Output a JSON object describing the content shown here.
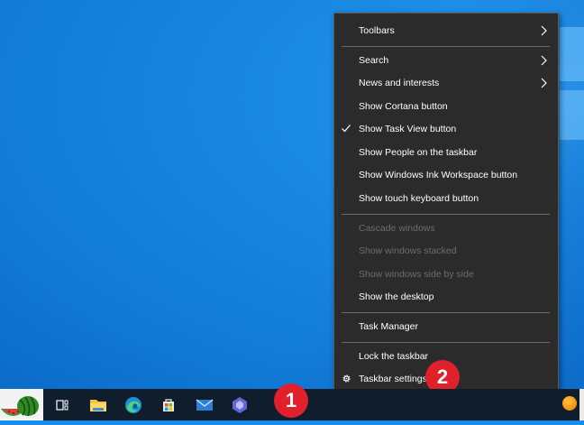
{
  "menu": {
    "toolbars": "Toolbars",
    "search": "Search",
    "news": "News and interests",
    "cortana": "Show Cortana button",
    "taskview": "Show Task View button",
    "people": "Show People on the taskbar",
    "ink": "Show Windows Ink Workspace button",
    "keyboard": "Show touch keyboard button",
    "cascade": "Cascade windows",
    "stacked": "Show windows stacked",
    "sidebyside": "Show windows side by side",
    "desktop": "Show the desktop",
    "taskmanager": "Task Manager",
    "lock": "Lock the taskbar",
    "settings": "Taskbar settings"
  },
  "badges": {
    "one": "1",
    "two": "2"
  },
  "taskbar": {
    "icons": [
      "watermelon-icon",
      "task-view-icon",
      "file-explorer-icon",
      "edge-icon",
      "store-icon",
      "mail-icon",
      "copilot-icon"
    ]
  },
  "colors": {
    "menu_bg": "#2b2b2b",
    "badge": "#e0202a",
    "taskbar": "#101d2c"
  }
}
